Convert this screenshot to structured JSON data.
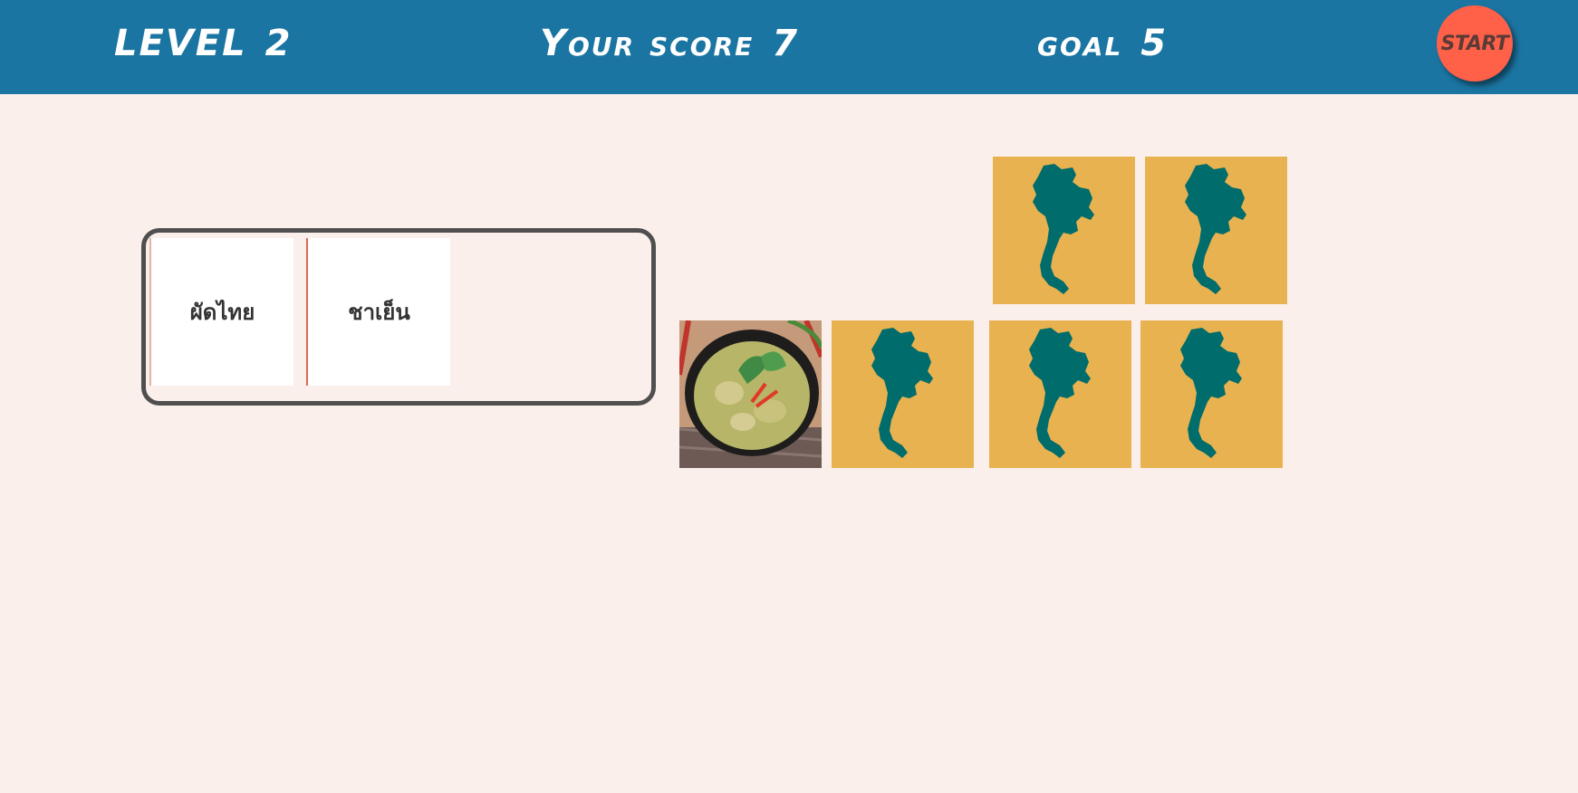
{
  "header": {
    "level_label": "LEVEL",
    "level_value": "2",
    "score_label": "Your score",
    "score_value": "7",
    "goal_label": "goal",
    "goal_value": "5",
    "start_button": "START"
  },
  "colors": {
    "header_bg": "#1b75a2",
    "page_bg": "#fbefeb",
    "start_button": "#ff6048",
    "tile_back": "#e8b250",
    "map_silhouette": "#006c6b",
    "tray_border": "#4f4f4f"
  },
  "match_tray": {
    "cards": [
      {
        "text": "ผัดไทย"
      },
      {
        "text": "ชาเย็น"
      }
    ]
  },
  "board": {
    "tiles": [
      {
        "face": "thailand-map-icon",
        "revealed": false
      },
      {
        "face": "thailand-map-icon",
        "revealed": false
      },
      {
        "face": "green-curry-photo",
        "revealed": true
      },
      {
        "face": "thailand-map-icon",
        "revealed": false
      },
      {
        "face": "thailand-map-icon",
        "revealed": false
      },
      {
        "face": "thailand-map-icon",
        "revealed": false
      }
    ]
  }
}
